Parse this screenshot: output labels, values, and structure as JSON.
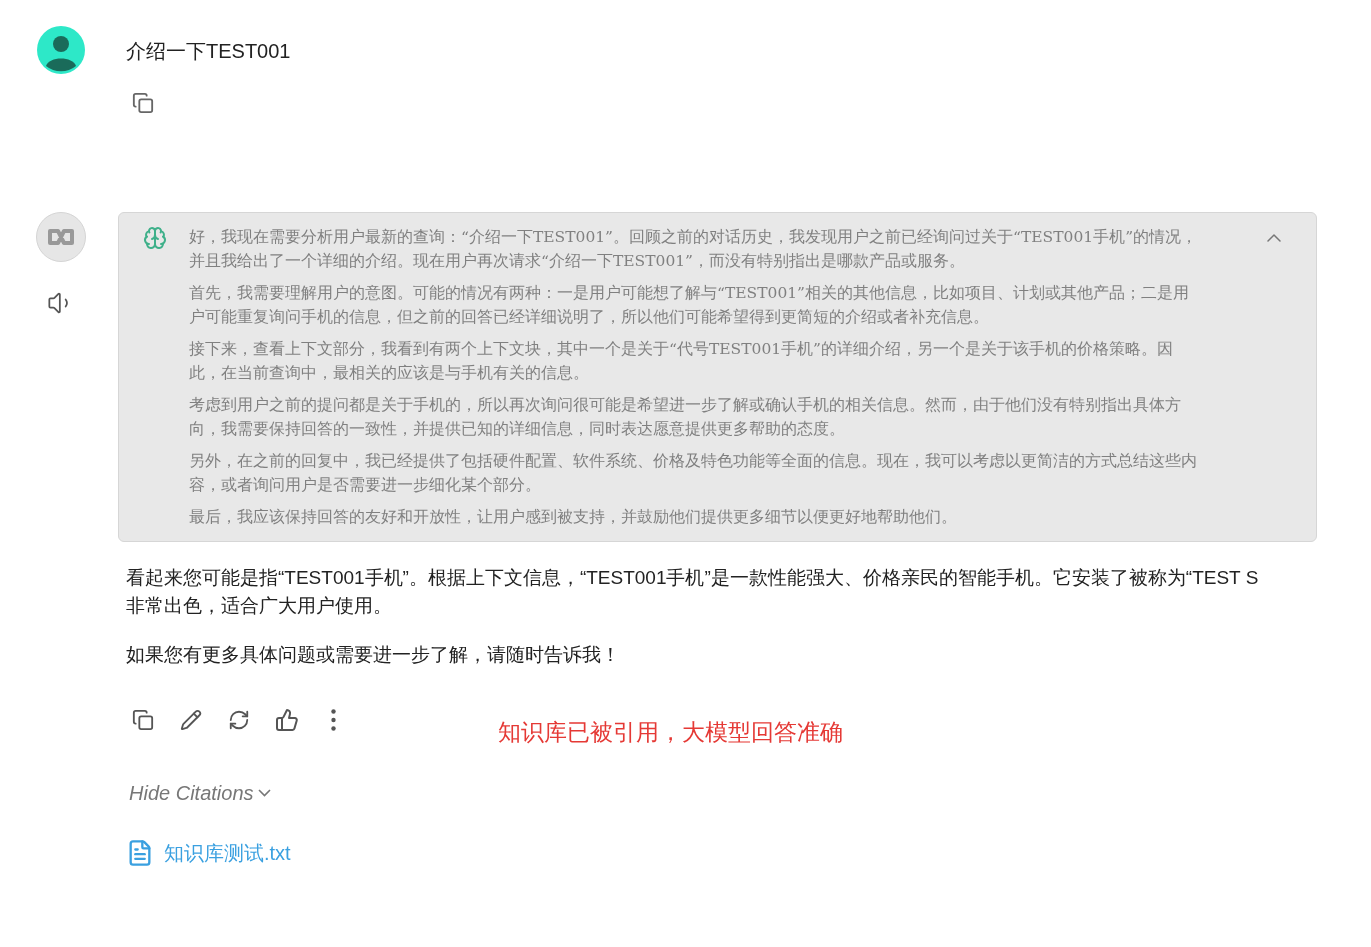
{
  "user_message": {
    "text": "介绍一下TEST001"
  },
  "thinking": {
    "expanded": true,
    "paragraphs": [
      "好，我现在需要分析用户最新的查询：“介绍一下TEST001”。回顾之前的对话历史，我发现用户之前已经询问过关于“TEST001手机”的情况，并且我给出了一个详细的介绍。现在用户再次请求“介绍一下TEST001”，而没有特别指出是哪款产品或服务。",
      "首先，我需要理解用户的意图。可能的情况有两种：一是用户可能想了解与“TEST001”相关的其他信息，比如项目、计划或其他产品；二是用户可能重复询问手机的信息，但之前的回答已经详细说明了，所以他们可能希望得到更简短的介绍或者补充信息。",
      "接下来，查看上下文部分，我看到有两个上下文块，其中一个是关于“代号TEST001手机”的详细介绍，另一个是关于该手机的价格策略。因此，在当前查询中，最相关的应该是与手机有关的信息。",
      "考虑到用户之前的提问都是关于手机的，所以再次询问很可能是希望进一步了解或确认手机的相关信息。然而，由于他们没有特别指出具体方向，我需要保持回答的一致性，并提供已知的详细信息，同时表达愿意提供更多帮助的态度。",
      "另外，在之前的回复中，我已经提供了包括硬件配置、软件系统、价格及特色功能等全面的信息。现在，我可以考虑以更简洁的方式总结这些内容，或者询问用户是否需要进一步细化某个部分。",
      "最后，我应该保持回答的友好和开放性，让用户感到被支持，并鼓励他们提供更多细节以便更好地帮助他们。"
    ]
  },
  "answer": {
    "lines": [
      "看起来您可能是指“TEST001手机”。根据上下文信息，“TEST001手机”是一款性能强大、价格亲民的智能手机。它安装了被称为“TEST S",
      "非常出色，适合广大用户使用。"
    ],
    "closing": "如果您有更多具体问题或需要进一步了解，请随时告诉我！"
  },
  "annotation": "知识库已被引用，大模型回答准确",
  "citations": {
    "toggle": "Hide Citations",
    "expanded": true,
    "files": [
      "知识库测试.txt"
    ]
  }
}
